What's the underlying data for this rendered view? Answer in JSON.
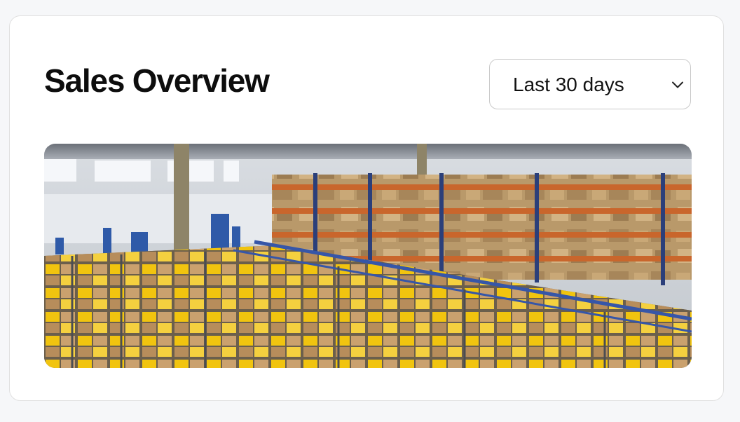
{
  "card": {
    "title": "Sales Overview",
    "period_select": {
      "value": "Last 30 days",
      "icon": "chevron-down-icon"
    },
    "hero_image": {
      "subject": "warehouse"
    }
  },
  "colors": {
    "page_background": "#f6f7f9",
    "card_background": "#ffffff",
    "card_border": "#e0e0e0",
    "title_text": "#0d0d0d",
    "select_border": "#c9c9c9"
  }
}
